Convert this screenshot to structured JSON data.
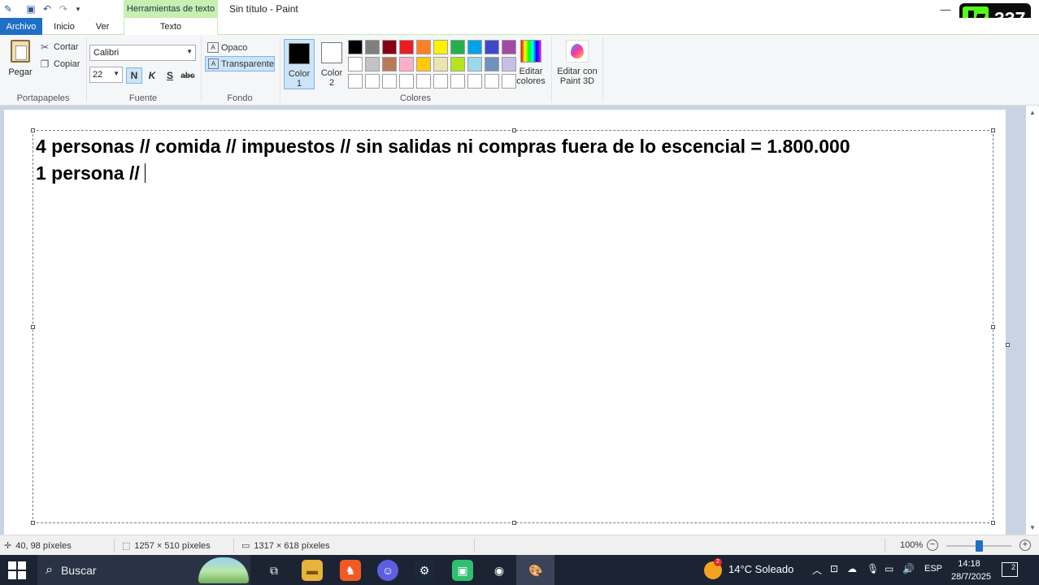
{
  "window": {
    "title": "Sin título - Paint",
    "context_tab_header": "Herramientas de texto"
  },
  "badge": {
    "value": "337",
    "brand_color": "#53fc18"
  },
  "tabs": {
    "archivo": "Archivo",
    "inicio": "Inicio",
    "ver": "Ver",
    "texto": "Texto"
  },
  "ribbon": {
    "clipboard": {
      "paste": "Pegar",
      "cut": "Cortar",
      "copy": "Copiar",
      "group": "Portapapeles"
    },
    "font": {
      "name": "Calibri",
      "size": "22",
      "bold": "N",
      "italic": "K",
      "underline": "S",
      "strike": "abc",
      "group": "Fuente"
    },
    "background": {
      "opaque": "Opaco",
      "transparent": "Transparente",
      "group": "Fondo"
    },
    "colors": {
      "color1_label": "Color",
      "color1_num": "1",
      "color2_label": "Color",
      "color2_num": "2",
      "edit_line1": "Editar",
      "edit_line2": "colores",
      "group": "Colores",
      "color1_value": "#000000",
      "color2_value": "#ffffff",
      "palette": [
        "#000000",
        "#7f7f7f",
        "#880015",
        "#ed1c24",
        "#ff7f27",
        "#fff200",
        "#22b14c",
        "#00a2e8",
        "#3f48cc",
        "#a349a4",
        "#ffffff",
        "#c3c3c3",
        "#b97a57",
        "#ffaec9",
        "#ffc90e",
        "#efe4b0",
        "#b5e61d",
        "#99d9ea",
        "#7092be",
        "#c8bfe7",
        "#ffffff",
        "#ffffff",
        "#ffffff",
        "#ffffff",
        "#ffffff",
        "#ffffff",
        "#ffffff",
        "#ffffff",
        "#ffffff",
        "#ffffff"
      ]
    },
    "paint3d": {
      "line1": "Editar con",
      "line2": "Paint 3D"
    }
  },
  "canvas": {
    "line1": "4 personas // comida // impuestos // sin salidas ni compras fuera de lo escencial = 1.800.000",
    "line2": "1 persona //"
  },
  "status": {
    "cursor": "40, 98 píxeles",
    "selection": "1257 × 510 píxeles",
    "image_size": "1317 × 618 píxeles",
    "zoom": "100%",
    "zoom_level": 0.5
  },
  "taskbar": {
    "search": "Buscar",
    "weather_badge": "2",
    "weather": "14°C  Soleado",
    "lang": "ESP",
    "time": "14:18",
    "date": "28/7/2025",
    "notifications": "2"
  }
}
